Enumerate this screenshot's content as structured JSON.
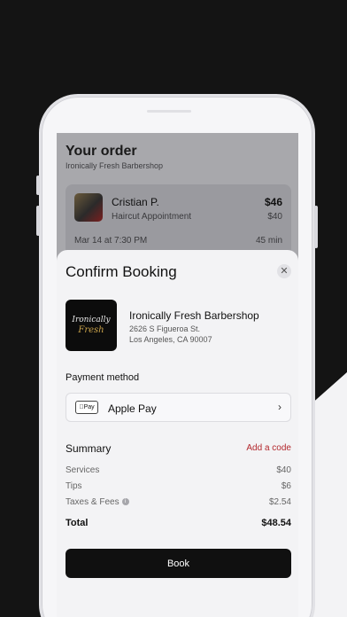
{
  "order": {
    "title": "Your order",
    "shop_name": "Ironically Fresh Barbershop",
    "barber_name": "Cristian P.",
    "appointment_type": "Haircut Appointment",
    "price_total": "$46",
    "price_service": "$40",
    "date_time": "Mar 14 at 7:30 PM",
    "duration": "45 min"
  },
  "sheet": {
    "title": "Confirm Booking",
    "close_icon": "close-icon",
    "shop": {
      "name": "Ironically Fresh Barbershop",
      "address_line1": "2626 S Figueroa St.",
      "address_line2": "Los Angeles, CA 90007",
      "logo_line1": "Ironically",
      "logo_line2": "Fresh"
    },
    "payment": {
      "label": "Payment method",
      "badge": "Pay",
      "method": "Apple Pay",
      "chevron": "›"
    },
    "summary": {
      "title": "Summary",
      "add_code": "Add a code",
      "rows": [
        {
          "label": "Services",
          "value": "$40"
        },
        {
          "label": "Tips",
          "value": "$6"
        },
        {
          "label": "Taxes & Fees",
          "value": "$2.54"
        }
      ],
      "total_label": "Total",
      "total_value": "$48.54"
    },
    "book_label": "Book"
  },
  "colors": {
    "accent_red": "#b3282d",
    "button_dark": "#101010",
    "background_dark": "#141414"
  }
}
